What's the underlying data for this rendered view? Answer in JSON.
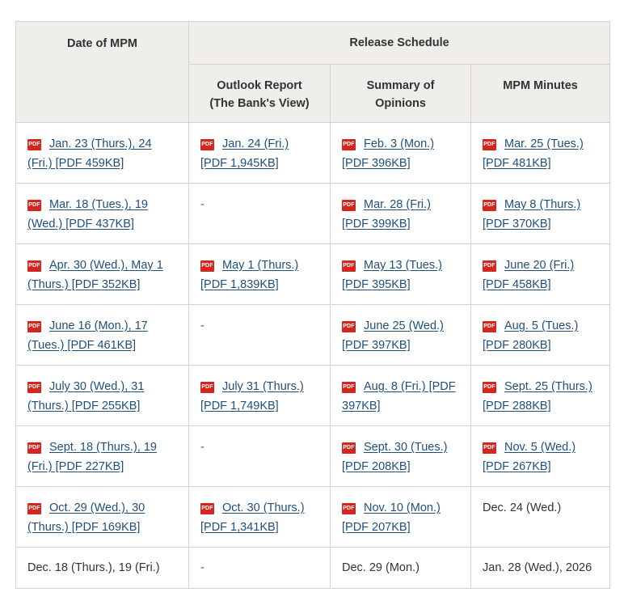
{
  "headers": {
    "date": "Date of MPM",
    "release": "Release Schedule",
    "outlook_line1": "Outlook Report",
    "outlook_line2": "(The Bank's View)",
    "summary_line1": "Summary of",
    "summary_line2": "Opinions",
    "minutes": "MPM Minutes"
  },
  "icons": {
    "pdf": "PDF"
  },
  "rows": [
    {
      "date": "Jan. 23 (Thurs.), 24 (Fri.) [PDF 459KB]",
      "outlook": "Jan. 24 (Fri.) [PDF 1,945KB]",
      "summary": "Feb. 3 (Mon.) [PDF 396KB]",
      "minutes": "Mar. 25 (Tues.) [PDF 481KB]"
    },
    {
      "date": "Mar. 18 (Tues.), 19 (Wed.) [PDF 437KB]",
      "outlook": "-",
      "summary": "Mar. 28 (Fri.) [PDF 399KB]",
      "minutes": "May 8 (Thurs.) [PDF 370KB]"
    },
    {
      "date": "Apr. 30 (Wed.), May 1 (Thurs.) [PDF 352KB]",
      "outlook": "May 1 (Thurs.) [PDF 1,839KB]",
      "summary": "May 13 (Tues.) [PDF 395KB]",
      "minutes": "June 20 (Fri.) [PDF 458KB]"
    },
    {
      "date": "June 16 (Mon.), 17 (Tues.) [PDF 461KB]",
      "outlook": "-",
      "summary": "June 25 (Wed.) [PDF 397KB]",
      "minutes": "Aug. 5 (Tues.) [PDF 280KB]"
    },
    {
      "date": "July 30 (Wed.), 31 (Thurs.) [PDF 255KB]",
      "outlook": "July 31 (Thurs.) [PDF 1,749KB]",
      "summary": "Aug. 8 (Fri.) [PDF 397KB]",
      "minutes": "Sept. 25 (Thurs.) [PDF 288KB]"
    },
    {
      "date": "Sept. 18 (Thurs.), 19 (Fri.) [PDF 227KB]",
      "outlook": "-",
      "summary": "Sept. 30 (Tues.) [PDF 208KB]",
      "minutes": "Nov. 5 (Wed.) [PDF 267KB]"
    },
    {
      "date": "Oct. 29 (Wed.), 30 (Thurs.) [PDF 169KB]",
      "outlook": "Oct. 30 (Thurs.) [PDF 1,341KB]",
      "summary": "Nov. 10 (Mon.) [PDF 207KB]",
      "minutes": "Dec. 24 (Wed.)"
    },
    {
      "date": "Dec. 18 (Thurs.), 19 (Fri.)",
      "outlook": "-",
      "summary": "Dec. 29 (Mon.)",
      "minutes": "Jan. 28 (Wed.), 2026"
    }
  ]
}
